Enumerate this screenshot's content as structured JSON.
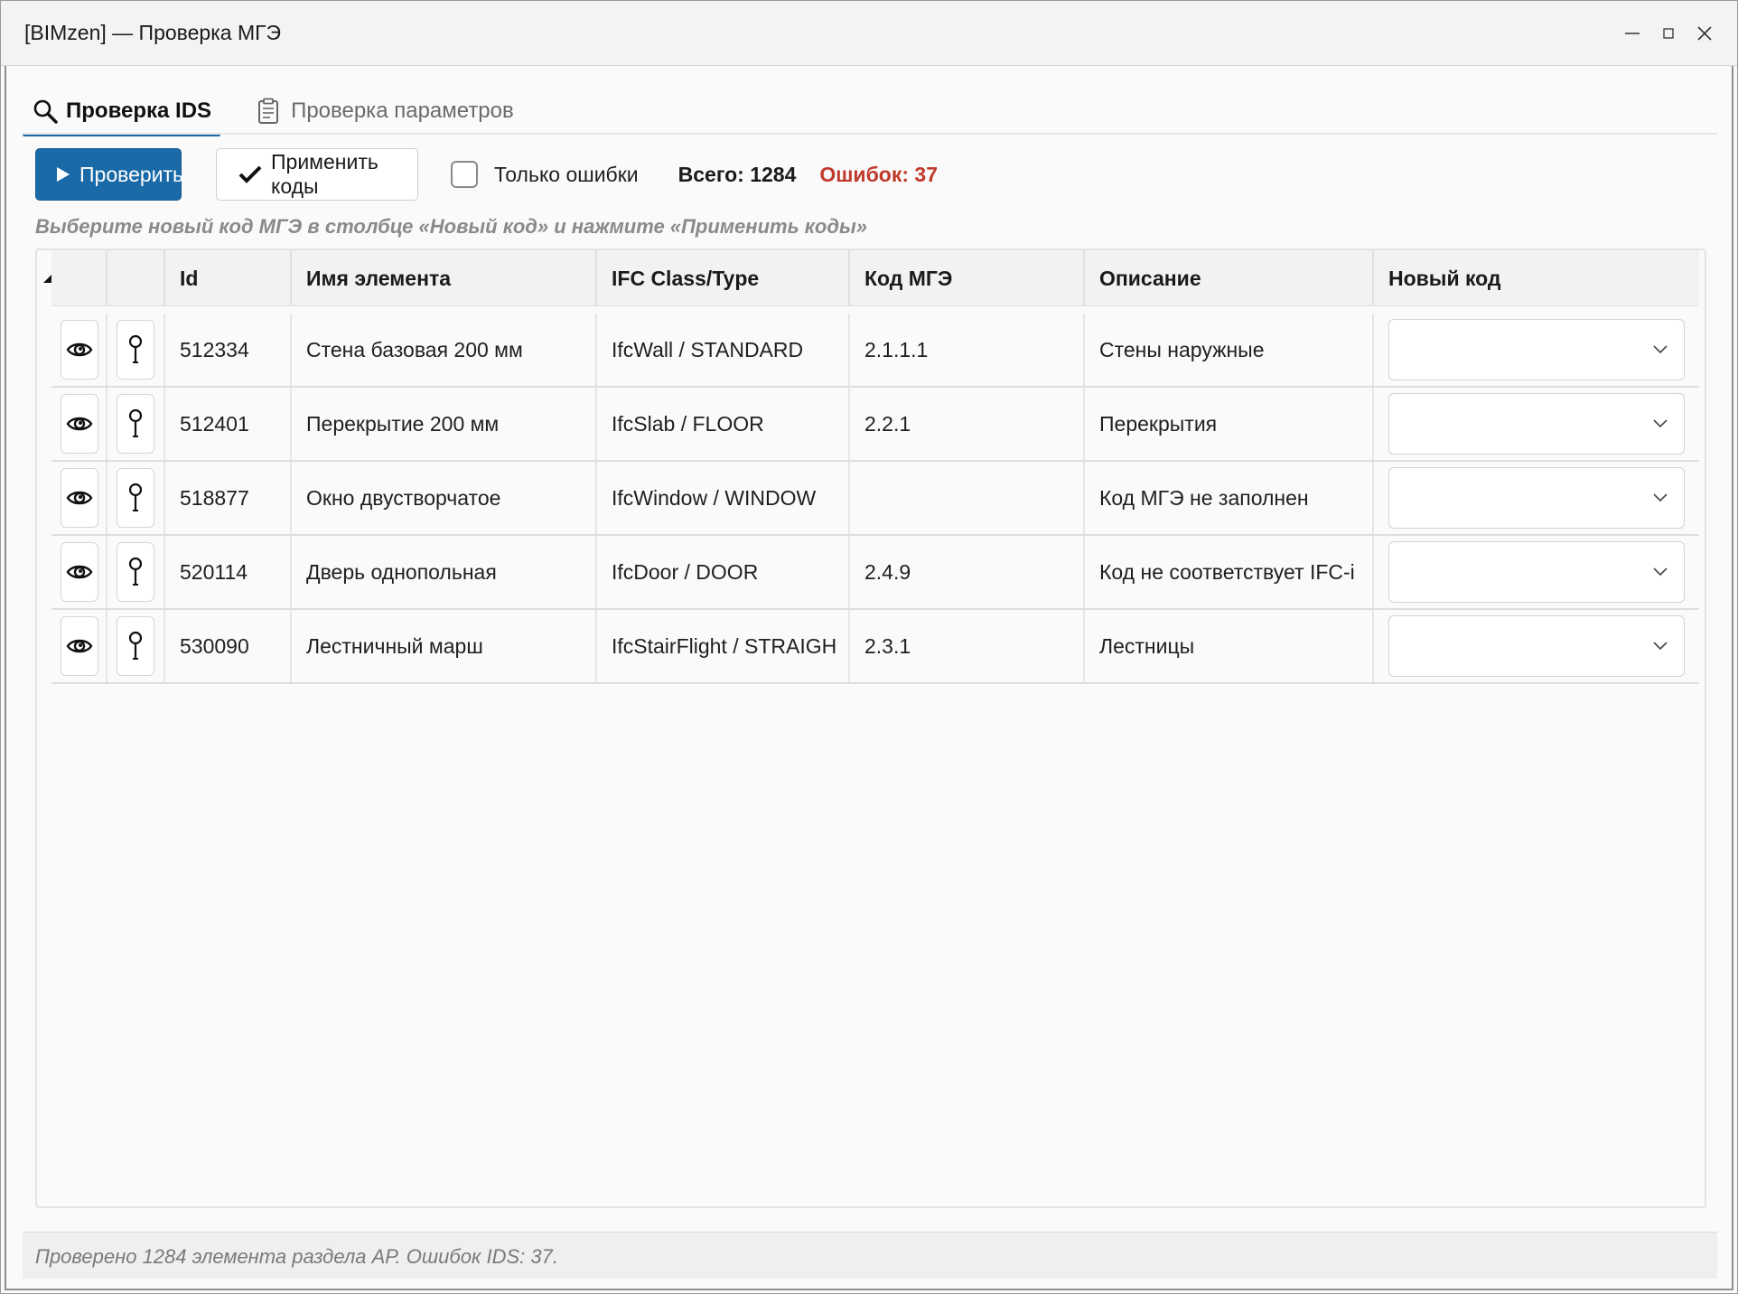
{
  "window": {
    "title": "[BIMzen] — Проверка МГЭ"
  },
  "tabs": [
    {
      "label": "Проверка IDS",
      "icon": "search-icon",
      "active": true
    },
    {
      "label": "Проверка параметров",
      "icon": "clipboard-icon",
      "active": false
    }
  ],
  "toolbar": {
    "check_label": "Проверить",
    "apply_label": "Применить коды",
    "only_errors_label": "Только ошибки",
    "only_errors_checked": false,
    "total_label": "Всего:",
    "total_value": "1284",
    "errors_label": "Ошибок:",
    "errors_value": "37"
  },
  "hint": "Выберите новый код МГЭ в столбце «Новый код» и нажмите «Применить коды»",
  "table": {
    "columns": [
      "",
      "",
      "Id",
      "Имя элемента",
      "IFC Class/Type",
      "Код МГЭ",
      "Описание",
      "Новый код"
    ],
    "rows": [
      {
        "id": "512334",
        "name": "Стена базовая 200 мм",
        "ifc": "IfcWall / STANDARD",
        "code": "2.1.1.1",
        "desc": "Стены наружные",
        "new_code": ""
      },
      {
        "id": "512401",
        "name": "Перекрытие 200 мм",
        "ifc": "IfcSlab / FLOOR",
        "code": "2.2.1",
        "desc": "Перекрытия",
        "new_code": ""
      },
      {
        "id": "518877",
        "name": "Окно двустворчатое",
        "ifc": "IfcWindow / WINDOW",
        "code": "",
        "desc": "Код МГЭ не заполнен",
        "new_code": ""
      },
      {
        "id": "520114",
        "name": "Дверь однопольная",
        "ifc": "IfcDoor / DOOR",
        "code": "2.4.9",
        "desc": "Код не соответствует IFC-i",
        "new_code": ""
      },
      {
        "id": "530090",
        "name": "Лестничный марш",
        "ifc": "IfcStairFlight / STRAIGH",
        "code": "2.3.1",
        "desc": "Лестницы",
        "new_code": ""
      }
    ]
  },
  "status": "Проверено 1284 элемента раздела АР. Ошибок IDS: 37.",
  "colors": {
    "accent": "#1b6aa8",
    "error": "#c0392b"
  }
}
